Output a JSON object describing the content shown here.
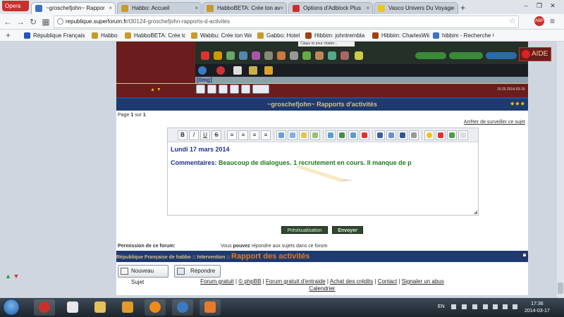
{
  "browser": {
    "opera_label": "Opera",
    "tabs": [
      {
        "title": "~groschefjohn~ Rappor",
        "color": "#3b6fc7",
        "active": true
      },
      {
        "title": "Habbo: Accueil",
        "color": "#c99a2a",
        "active": false
      },
      {
        "title": "HabboBETA: Crée ton av",
        "color": "#c99a2a",
        "active": false
      },
      {
        "title": "Options d'Adblock Plus",
        "color": "#c9302c",
        "active": false
      },
      {
        "title": "Vasco Univers Du Voyage",
        "color": "#e8c62b",
        "active": false
      }
    ],
    "new_tab_label": "+",
    "url_host": "republique.superforum.fr",
    "url_path": "/t30124-groschefjohn-rapports-d-activites",
    "bookmarks": [
      {
        "label": "République Français",
        "color": "#2a52be"
      },
      {
        "label": "Habbo",
        "color": "#c99a2a"
      },
      {
        "label": "HabboBETA: Crée ton",
        "color": "#c99a2a"
      },
      {
        "label": "Wabbu: Crée ton Wa",
        "color": "#c99a2a"
      },
      {
        "label": "Gabbo: Hotel",
        "color": "#c99a2a"
      },
      {
        "label": "Hibbim: johntrembla",
        "color": "#a04010"
      },
      {
        "label": "Hibbim: CharlesWii",
        "color": "#a04010"
      },
      {
        "label": "hibbim - Recherche G",
        "color": "#3b6fc7"
      }
    ]
  },
  "page": {
    "image_tag": "[/img]",
    "embedded_tooltip": "Clique ici pour chatter...",
    "embedded_clock": "15:20\n2014-03-16",
    "topic_title": "~groschefjohn~ Rapports d'activités",
    "pagination": {
      "prefix": "Page",
      "current": "1",
      "sep": "sur",
      "total": "1"
    },
    "unwatch_link": "Arrêter de surveiller ce sujet",
    "editor": {
      "date_line": "Lundi 17 mars 2014",
      "comment_label": "Commentaires:",
      "comment_text": "Beaucoup de dialogues. 1 recrutement en cours. Il manque de p"
    },
    "preview_button": "Prévisualisation",
    "send_button": "Envoyer",
    "permission_label": "Permission de ce forum:",
    "permission_text_a": "Vous",
    "permission_text_b": "pouvez",
    "permission_text_c": "répondre aux sujets dans ce forum",
    "breadcrumb_a": "République Française de habbo",
    "breadcrumb_sep1": "::",
    "breadcrumb_b": "Intervention",
    "breadcrumb_sep2": "::",
    "breadcrumb_current": "Rapport des activités",
    "new_topic_button": "Nouveau Sujet",
    "reply_button": "Répondre",
    "footer_links": [
      "Forum gratuit",
      "© phpBB",
      "Forum gratuit d'entraide",
      "Achat des crédits",
      "Contact",
      "Signaler un abus"
    ],
    "footer_sep": "|",
    "footer_line2": "Calendrier",
    "aide_button": "AIDE"
  },
  "taskbar": {
    "lang": "EN",
    "time": "17:36",
    "date": "2014-03-17"
  }
}
